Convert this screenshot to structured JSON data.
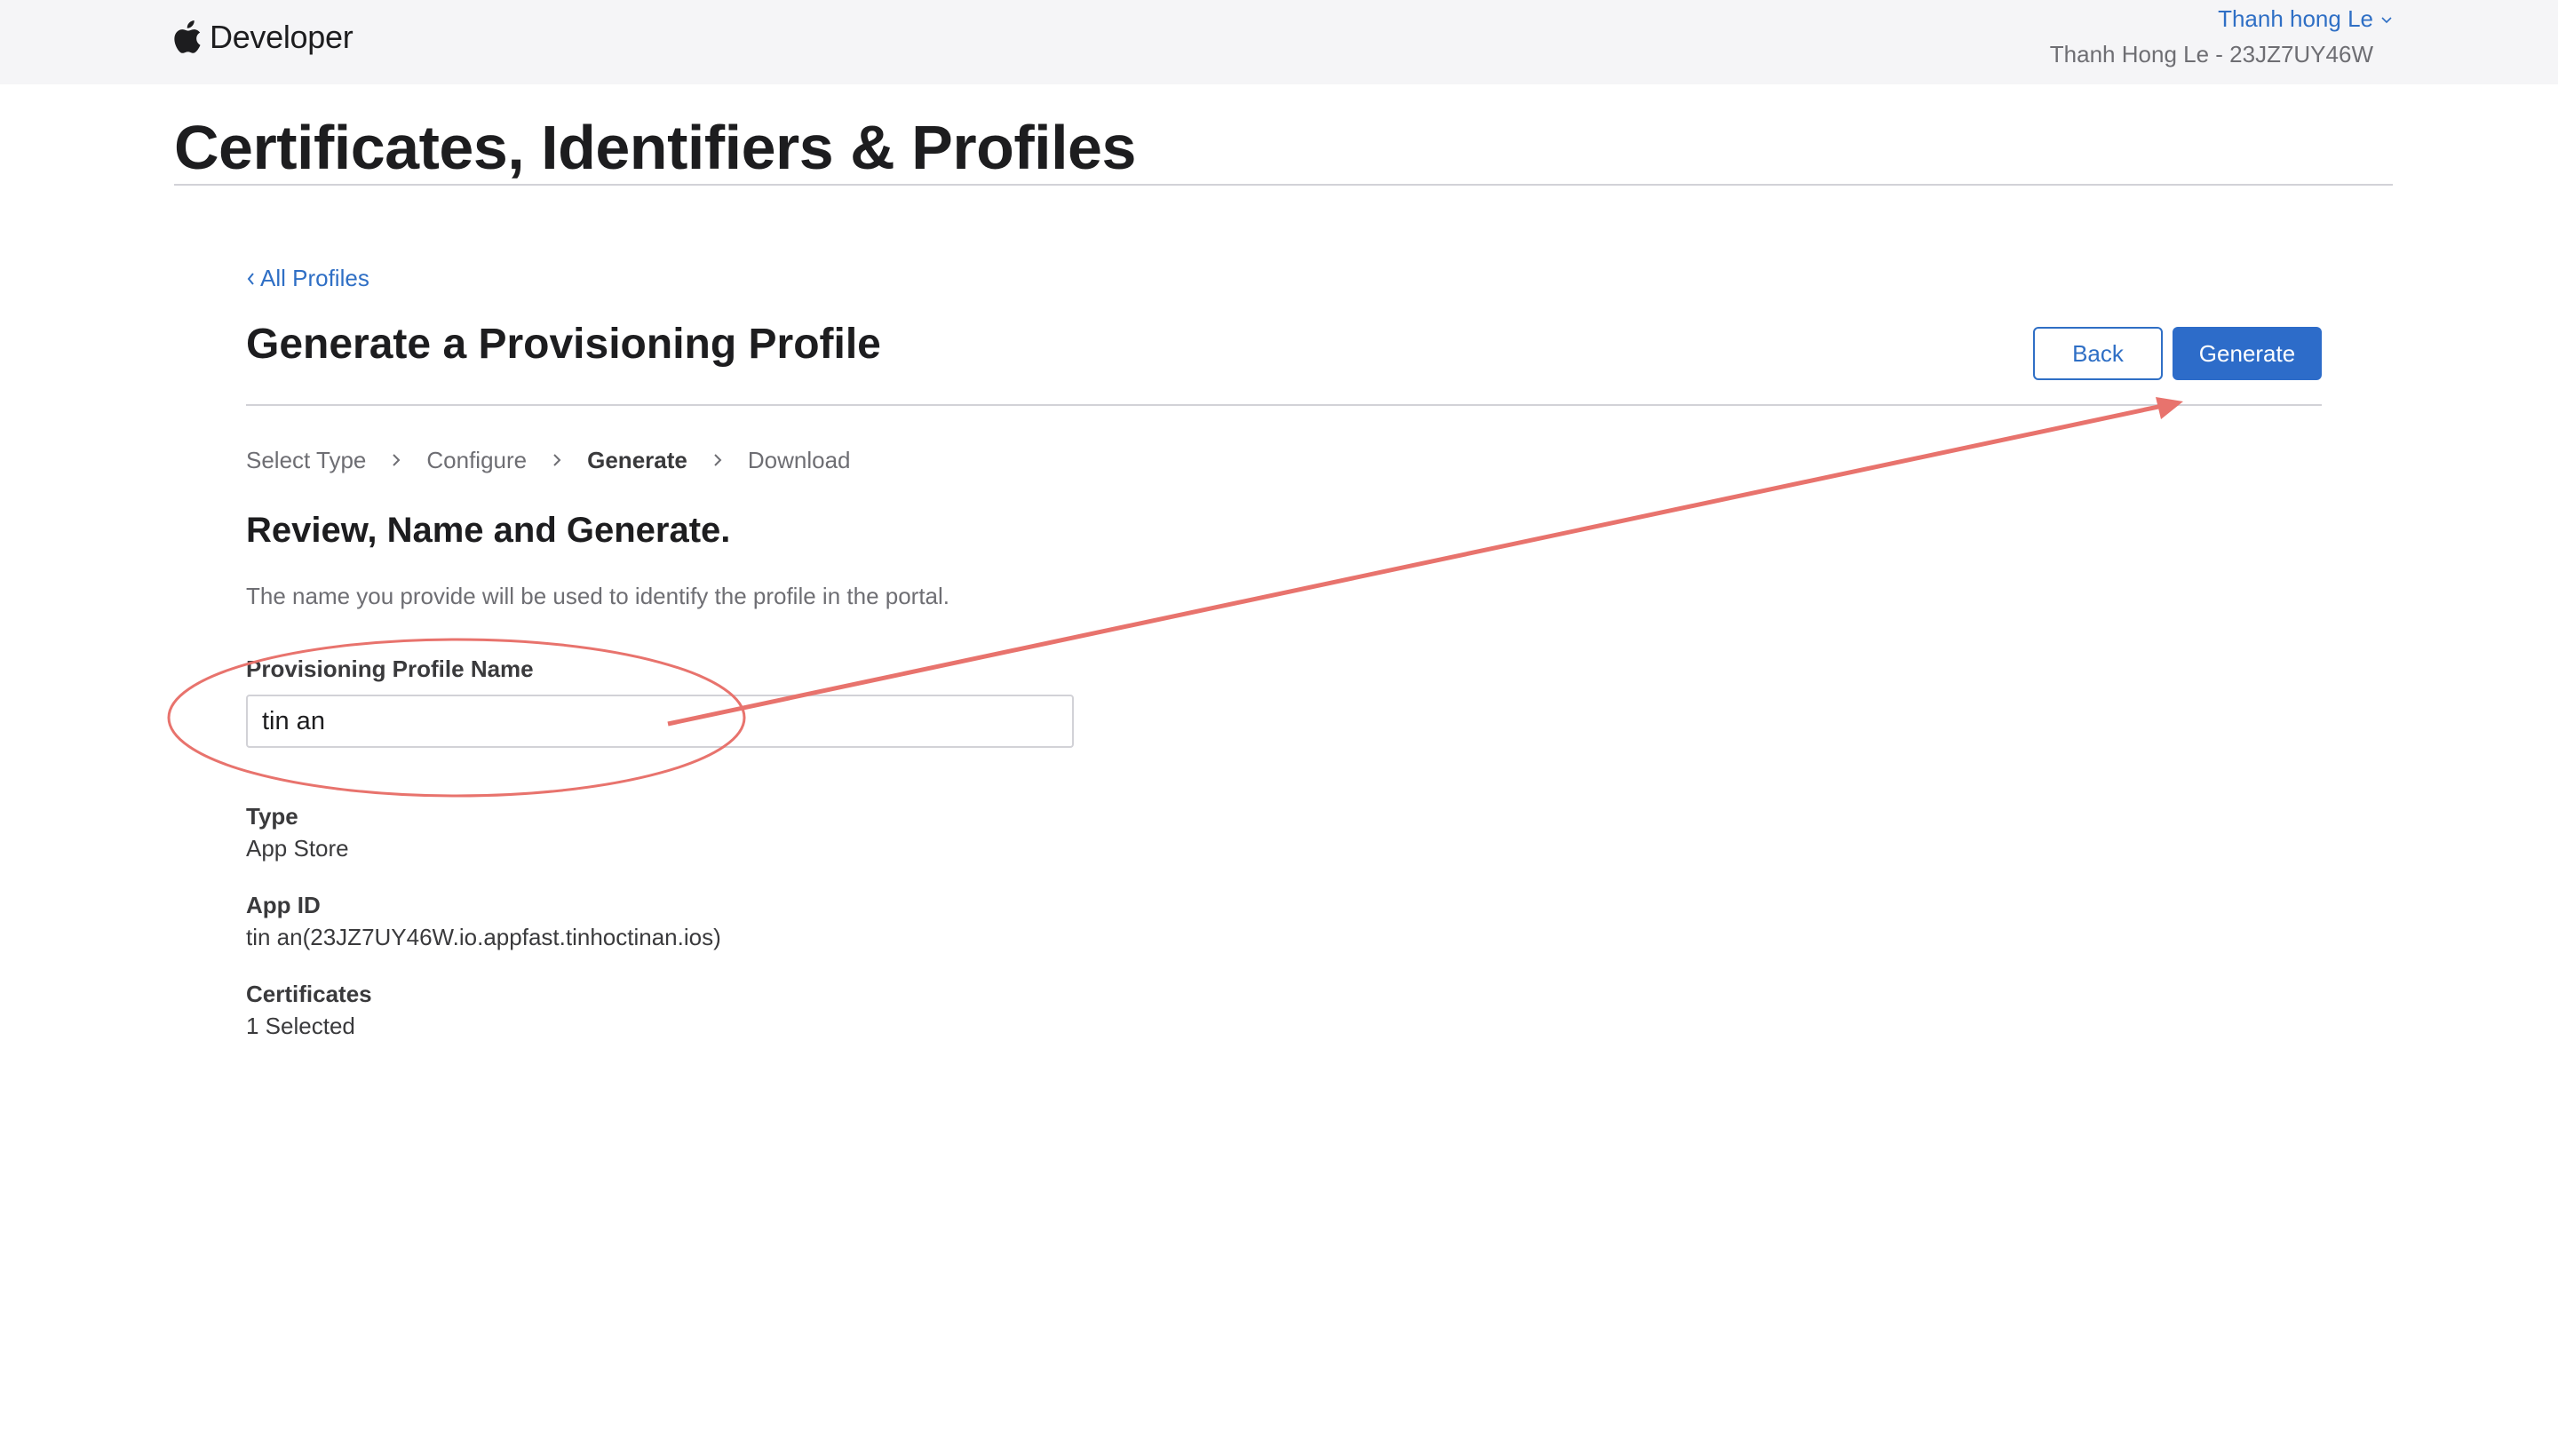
{
  "header": {
    "brand": "Developer",
    "account_name": "Thanh hong Le",
    "team_line": "Thanh Hong Le - 23JZ7UY46W"
  },
  "page": {
    "title": "Certificates, Identifiers & Profiles"
  },
  "main": {
    "back_link": "All Profiles",
    "section_title": "Generate a Provisioning Profile",
    "buttons": {
      "back_label": "Back",
      "generate_label": "Generate"
    },
    "steps": [
      {
        "label": "Select Type",
        "current": false
      },
      {
        "label": "Configure",
        "current": false
      },
      {
        "label": "Generate",
        "current": true
      },
      {
        "label": "Download",
        "current": false
      }
    ],
    "subheading": "Review, Name and Generate.",
    "description": "The name you provide will be used to identify the profile in the portal.",
    "profile_name": {
      "label": "Provisioning Profile Name",
      "value": "tin an"
    },
    "details": {
      "type_label": "Type",
      "type_value": "App Store",
      "app_id_label": "App ID",
      "app_id_value": "tin an(23JZ7UY46W.io.appfast.tinhoctinan.ios)",
      "certificates_label": "Certificates",
      "certificates_value": "1 Selected"
    }
  },
  "colors": {
    "accent": "#2d6cc9",
    "annotation": "#e8736d",
    "topbar_bg": "#f5f5f7"
  },
  "icons": {
    "brand": "apple-logo-icon",
    "account_menu": "chevron-down-icon",
    "back": "chevron-left-icon",
    "step_separator": "chevron-right-icon"
  }
}
